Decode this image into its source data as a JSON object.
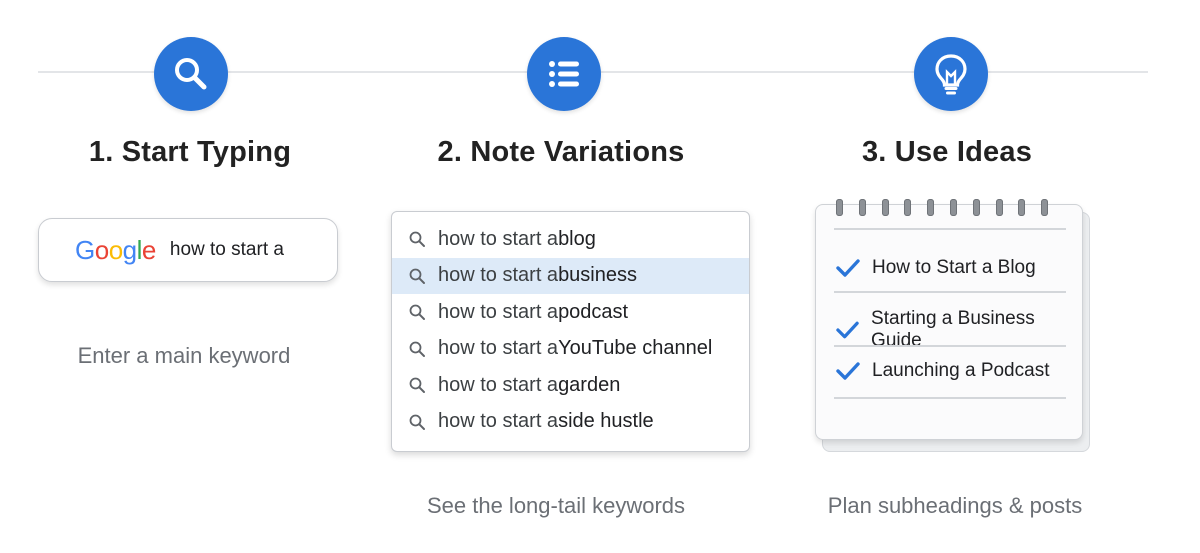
{
  "steps": [
    {
      "title": "1. Start Typing",
      "icon": "search-icon",
      "caption": "Enter a main keyword"
    },
    {
      "title": "2. Note Variations",
      "icon": "list-icon",
      "caption": "See the long-tail keywords"
    },
    {
      "title": "3. Use Ideas",
      "icon": "lightbulb-icon",
      "caption": "Plan subheadings & posts"
    }
  ],
  "search": {
    "logo": "Google",
    "query": "how to start a"
  },
  "suggestions": [
    {
      "base": "how to start a ",
      "tail": "blog",
      "highlighted": false
    },
    {
      "base": "how to start a ",
      "tail": "business",
      "highlighted": true
    },
    {
      "base": "how to start a ",
      "tail": "podcast",
      "highlighted": false
    },
    {
      "base": "how to start a ",
      "tail": "YouTube channel",
      "highlighted": false
    },
    {
      "base": "how to start a ",
      "tail": "garden",
      "highlighted": false
    },
    {
      "base": "how to start a ",
      "tail": "side hustle",
      "highlighted": false
    }
  ],
  "notepad": {
    "items": [
      "How to Start a Blog",
      "Starting a Business Guide",
      "Launching a Podcast"
    ]
  },
  "colors": {
    "accent": "#2a75d8",
    "highlight": "#ddeaf8",
    "google_blue": "#4285F4",
    "google_red": "#EA4335",
    "google_yellow": "#FBBC05",
    "google_green": "#34A853"
  }
}
